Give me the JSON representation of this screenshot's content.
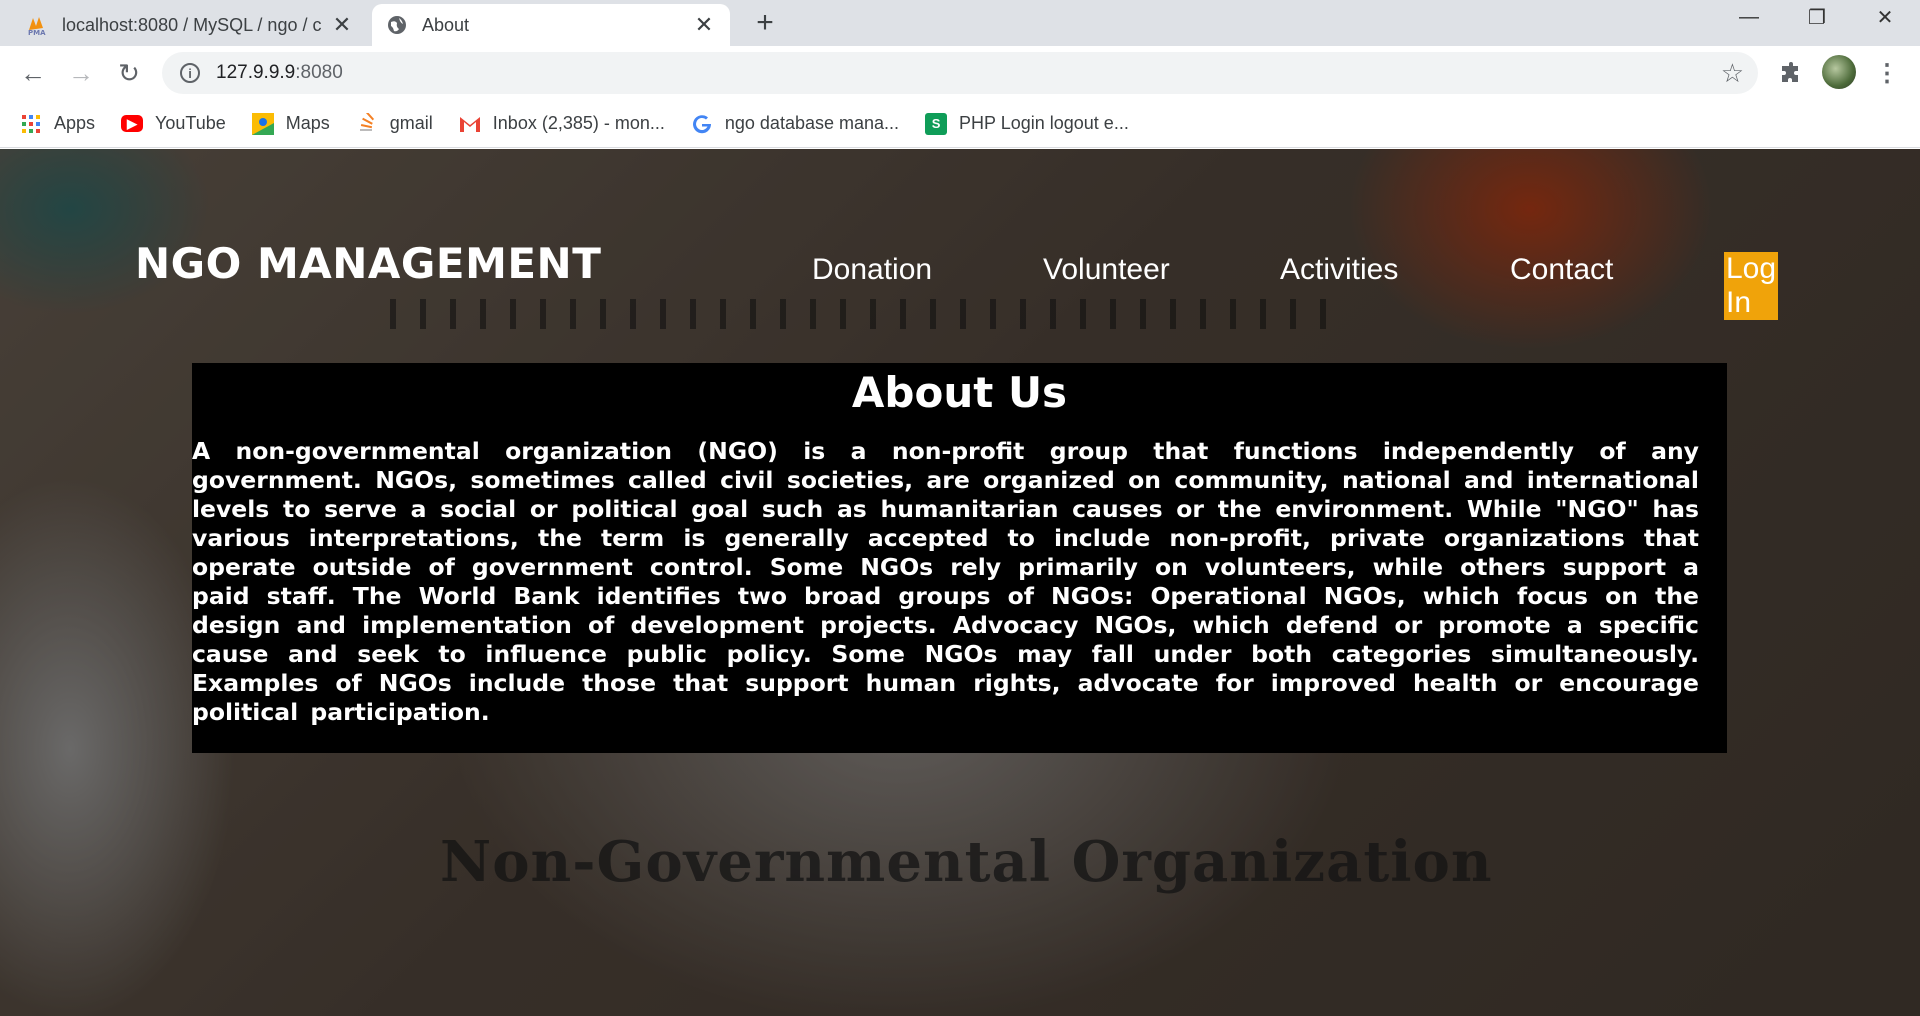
{
  "browser": {
    "tabs": [
      {
        "title": "localhost:8080 / MySQL / ngo / c",
        "favicon": "phpmyadmin-icon",
        "active": false
      },
      {
        "title": "About",
        "favicon": "globe-icon",
        "active": true
      }
    ],
    "url": {
      "host": "127.9.9.9",
      "port": ":8080"
    },
    "bookmarks": [
      {
        "label": "Apps",
        "icon": "apps-grid-icon"
      },
      {
        "label": "YouTube",
        "icon": "youtube-icon",
        "color": "#ff0000"
      },
      {
        "label": "Maps",
        "icon": "maps-icon",
        "color": "#fbbc04"
      },
      {
        "label": "gmail",
        "icon": "stackoverflow-icon",
        "color": "#f48024"
      },
      {
        "label": "Inbox (2,385) - mon...",
        "icon": "gmail-icon",
        "color": "#ea4335"
      },
      {
        "label": "ngo database mana...",
        "icon": "google-icon",
        "color": "#4285f4"
      },
      {
        "label": "PHP Login logout e...",
        "icon": "s-icon",
        "color": "#0f9d58"
      }
    ]
  },
  "site": {
    "logo": "NGO MANAGEMENT",
    "nav": {
      "donation": "Donation",
      "volunteer": "Volunteer",
      "activities": "Activities",
      "contact": "Contact",
      "login": "Log In"
    },
    "accent_color": "#f0a30a",
    "background_watermark": "Non-Governmental Organization",
    "about": {
      "title": "About Us",
      "body": "A non-governmental organization (NGO) is a non-profit group that functions independently of any government. NGOs, sometimes called civil societies, are organized on community, national and international levels to serve a social or political goal such as humanitarian causes or the environment. While \"NGO\" has various interpretations, the term is generally accepted to include non-profit, private organizations that operate outside of government control. Some NGOs rely primarily on volunteers, while others support a paid staff. The World Bank identifies two broad groups of NGOs: Operational NGOs, which focus on the design and implementation of development projects. Advocacy NGOs, which defend or promote a specific cause and seek to influence public policy. Some NGOs may fall under both categories simultaneously. Examples of NGOs include those that support human rights, advocate for improved health or encourage political participation."
    }
  }
}
